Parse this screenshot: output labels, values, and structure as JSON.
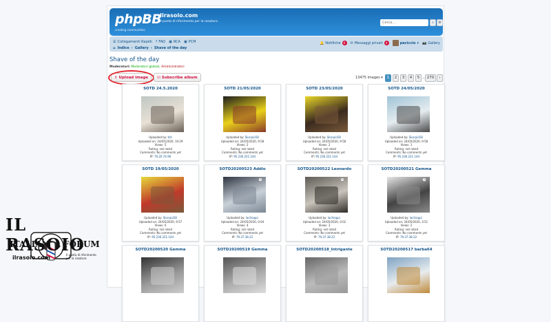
{
  "site": {
    "logo_text": "phpBB",
    "logo_tagline": "creating communities",
    "title": "Ilrasolo.com",
    "description": "Il punto di riferimento per la rasatura",
    "search_placeholder": "Cerca..."
  },
  "navbar": {
    "quick_links": "Collegamenti Rapidi",
    "faq": "FAQ",
    "rca": "RCA",
    "pcm": "PCM",
    "notifications": "Notifiche",
    "notifications_count": "6",
    "messages": "Messaggi privati",
    "messages_count": "4",
    "user": "paciccio",
    "gallery": "Gallery"
  },
  "breadcrumb": [
    "Indice",
    "Gallery",
    "Shave of the day"
  ],
  "page": {
    "title": "Shave of the day",
    "moderators_label": "Moderatori:",
    "moderator_global": "Moderatori globali",
    "moderator_admin": "Amministratori"
  },
  "actions": {
    "upload": "Upload image",
    "subscribe": "Subscribe album"
  },
  "pagination": {
    "count": "13475 images",
    "pages": [
      "1",
      "2",
      "3",
      "4",
      "5",
      "...",
      "270"
    ],
    "active": "1"
  },
  "cards": [
    {
      "title": "SOTD 24.5.2020",
      "uploader": "tkh",
      "uploaded_on": "24/05/2020, 10:29",
      "views": "5",
      "rating": "not rated",
      "comments": "No comments yet",
      "ip": "79.20.74.96"
    },
    {
      "title": "SOTD 21/05/2020",
      "uploader": "Skorpio58",
      "uploaded_on": "24/05/2020, 9:58",
      "views": "2",
      "rating": "not rated",
      "comments": "No comments yet",
      "ip": "95.236.221.144"
    },
    {
      "title": "SOTD 23/05/2020",
      "uploader": "Skorpio58",
      "uploaded_on": "24/05/2020, 9:58",
      "views": "2",
      "rating": "not rated",
      "comments": "No comments yet",
      "ip": "95.236.221.144"
    },
    {
      "title": "SOTD 24/05/2020",
      "uploader": "Skorpio58",
      "uploaded_on": "24/05/2020, 9:58",
      "views": "1",
      "rating": "not rated",
      "comments": "No comments yet",
      "ip": "95.236.221.144"
    },
    {
      "title": "SOTD 19/05/2020",
      "uploader": "Skorpio58",
      "uploaded_on": "24/05/2020, 9:57",
      "views": "0",
      "rating": "not rated",
      "comments": "No comments yet",
      "ip": "95.236.221.144"
    },
    {
      "title": "SOTD20200523 Addio",
      "uploader": "lachiappi",
      "uploaded_on": "24/05/2020, 0:04",
      "views": "4",
      "rating": "not rated",
      "comments": "No comments yet",
      "ip": "79.37.38.22"
    },
    {
      "title": "SOTD20200522 Leonardo",
      "uploader": "lachiappi",
      "uploaded_on": "24/05/2020, 0:02",
      "views": "3",
      "rating": "not rated",
      "comments": "No comments yet",
      "ip": "79.37.38.22"
    },
    {
      "title": "SOTD20200521 Gemma",
      "uploader": "lachiappi",
      "uploaded_on": "24/05/2020, 3:51",
      "views": "2",
      "rating": "not rated",
      "comments": "No comments yet",
      "ip": "79.37.38.22"
    },
    {
      "title": "SOTD20200520 Gemma"
    },
    {
      "title": "SOTD20200519 Gemma"
    },
    {
      "title": "SOTD20200518_Intrigante"
    },
    {
      "title": "SOTD20200517 barba64"
    }
  ],
  "labels": {
    "uploaded_by": "Uploaded by:",
    "uploaded_on": "Uploaded on:",
    "views": "Views:",
    "rating": "Rating:",
    "comments": "Comments:",
    "ip": "IP:"
  },
  "watermark": {
    "line1": "IL RASOIO",
    "line2": "ITALIAN",
    "line3": "FORUM",
    "site": "ilrasoio.com",
    "tagline": "Il punto di riferimento per la rasatura"
  }
}
